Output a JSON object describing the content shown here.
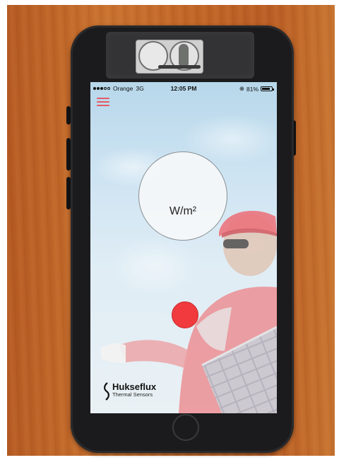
{
  "status_bar": {
    "carrier": "Orange",
    "network": "3G",
    "time": "12:05 PM",
    "battery": "81%",
    "battery_level": 0.81
  },
  "app": {
    "menu_icon": "hamburger-menu-icon",
    "gauge_unit": "W/m²",
    "record_color": "#f03a3d",
    "accent_color": "#e45a66"
  },
  "branding": {
    "name": "Hukseflux",
    "tagline": "Thermal Sensors"
  }
}
